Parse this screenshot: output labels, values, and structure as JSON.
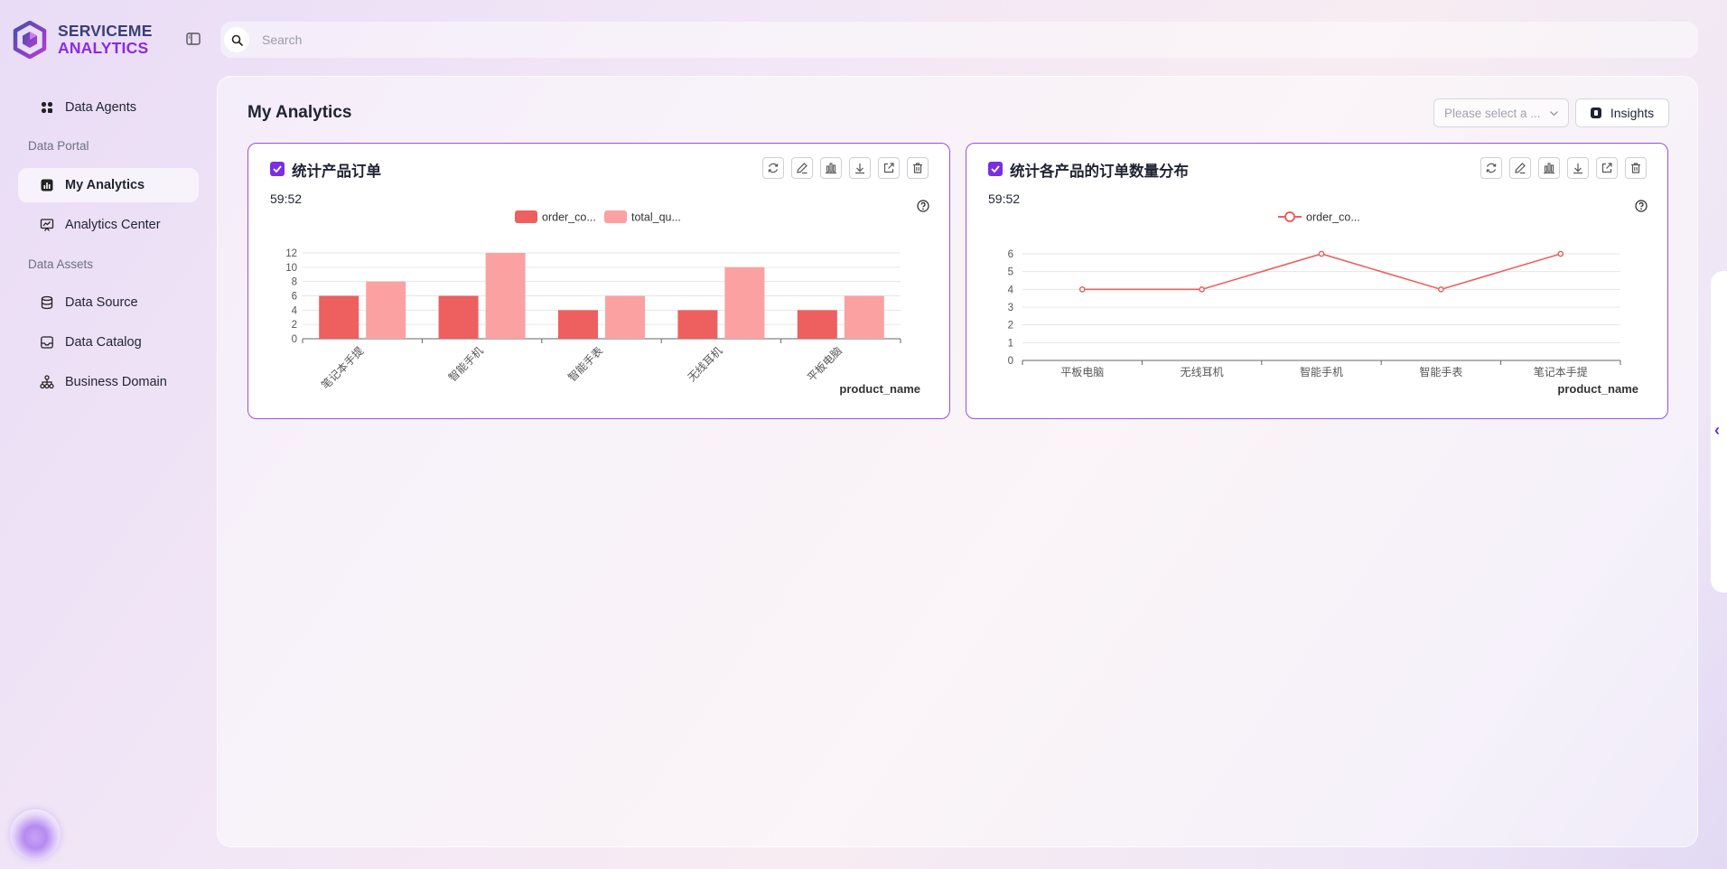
{
  "brand": {
    "line1": "SERVICEME",
    "line2": "ANALYTICS"
  },
  "search": {
    "placeholder": "Search"
  },
  "sidebar": {
    "items": [
      {
        "label": "Data Agents"
      },
      {
        "section": "Data Portal"
      },
      {
        "label": "My Analytics",
        "active": true
      },
      {
        "label": "Analytics Center"
      },
      {
        "section": "Data Assets"
      },
      {
        "label": "Data Source"
      },
      {
        "label": "Data Catalog"
      },
      {
        "label": "Business Domain"
      }
    ]
  },
  "main": {
    "title": "My Analytics",
    "select_placeholder": "Please select a ...",
    "insights_label": "Insights"
  },
  "colors": {
    "accent": "#7a2fe0",
    "series1": "#ee5f5f",
    "series2": "#fba1a1"
  },
  "cards": [
    {
      "title": "统计产品订单",
      "time": "59:52",
      "xlabel": "product_name"
    },
    {
      "title": "统计各产品的订单数量分布",
      "time": "59:52",
      "xlabel": "product_name"
    }
  ],
  "chart_data": [
    {
      "type": "bar",
      "categories": [
        "笔记本手提",
        "智能手机",
        "智能手表",
        "无线耳机",
        "平板电脑"
      ],
      "series": [
        {
          "name": "order_co...",
          "values": [
            6,
            6,
            4,
            4,
            4
          ]
        },
        {
          "name": "total_qu...",
          "values": [
            8,
            12,
            6,
            10,
            6
          ]
        }
      ],
      "yticks": [
        0,
        2,
        4,
        6,
        8,
        10,
        12
      ],
      "ylim": [
        0,
        12
      ],
      "xlabel": "product_name",
      "legend": "top-center",
      "grid": true
    },
    {
      "type": "line",
      "categories": [
        "平板电脑",
        "无线耳机",
        "智能手机",
        "智能手表",
        "笔记本手提"
      ],
      "series": [
        {
          "name": "order_co...",
          "values": [
            4,
            4,
            6,
            4,
            6
          ]
        }
      ],
      "yticks": [
        0,
        1,
        2,
        3,
        4,
        5,
        6
      ],
      "ylim": [
        0,
        6
      ],
      "xlabel": "product_name",
      "legend": "top-center",
      "grid": true
    }
  ]
}
